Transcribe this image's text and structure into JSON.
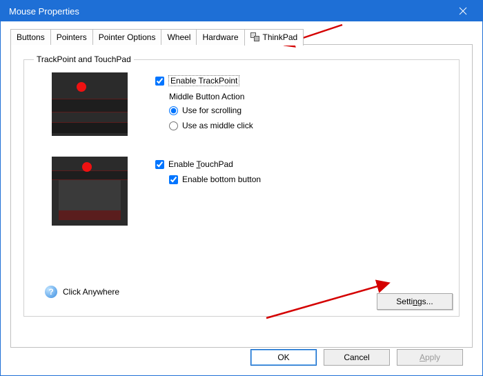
{
  "window": {
    "title": "Mouse Properties"
  },
  "tabs": {
    "buttons": "Buttons",
    "pointers": "Pointers",
    "pointer_options": "Pointer Options",
    "wheel": "Wheel",
    "hardware": "Hardware",
    "thinkpad": "ThinkPad"
  },
  "group": {
    "legend": "TrackPoint and TouchPad",
    "enable_trackpoint": "Enable TrackPoint",
    "middle_button_heading": "Middle Button Action",
    "use_for_scrolling": "Use for scrolling",
    "use_as_middle_click": "Use as middle click",
    "enable_touchpad_pre": "Enable ",
    "enable_touchpad_hot": "T",
    "enable_touchpad_post": "ouchPad",
    "enable_bottom_button": "Enable bottom button",
    "click_anywhere": "Click Anywhere",
    "settings_pre": "Setti",
    "settings_hot": "n",
    "settings_post": "gs..."
  },
  "buttons": {
    "ok": "OK",
    "cancel": "Cancel",
    "apply_pre": "",
    "apply_hot": "A",
    "apply_post": "pply"
  }
}
